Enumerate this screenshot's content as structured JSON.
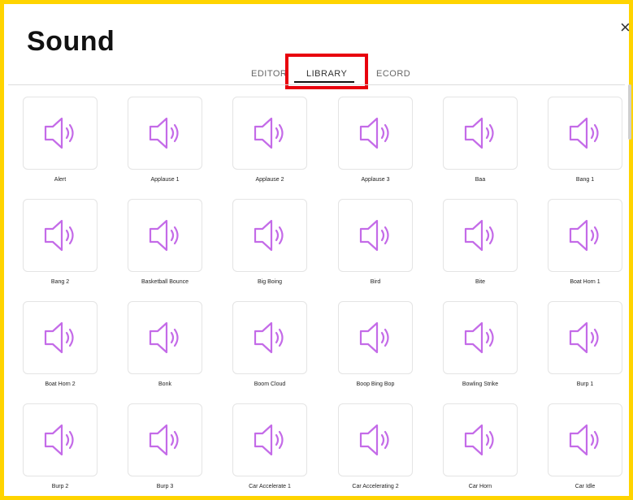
{
  "dialog": {
    "title": "Sound",
    "close_glyph": "×"
  },
  "tabs": [
    {
      "label": "EDITOR",
      "active": false
    },
    {
      "label": "LIBRARY",
      "active": true
    },
    {
      "label": "RECORD",
      "active": false
    }
  ],
  "tab_record_visible_label": "ECORD",
  "colors": {
    "frame": "#FFD400",
    "highlight": "#E8000D",
    "icon": "#C46BE8"
  },
  "sounds": [
    "Alert",
    "Applause 1",
    "Applause 2",
    "Applause 3",
    "Baa",
    "Bang 1",
    "Bang 2",
    "Basketball Bounce",
    "Big Boing",
    "Bird",
    "Bite",
    "Boat Horn 1",
    "Boat Horn 2",
    "Bonk",
    "Boom Cloud",
    "Boop Bing Bop",
    "Bowling Strike",
    "Burp 1",
    "Burp 2",
    "Burp 3",
    "Car Accelerate 1",
    "Car Accelerating 2",
    "Car Horn",
    "Car Idle"
  ],
  "sound_icon": "speaker-icon"
}
